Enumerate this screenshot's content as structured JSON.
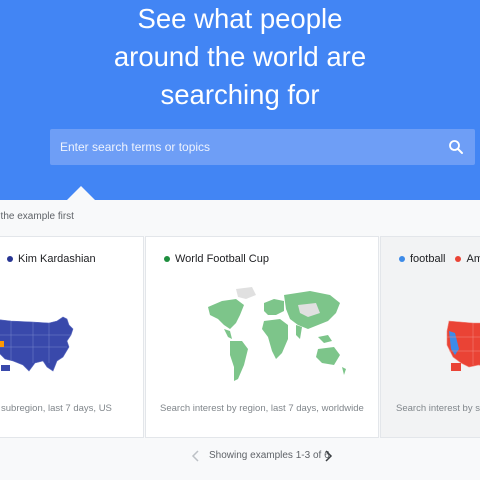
{
  "hero": {
    "title_lines": [
      "See what people",
      "around the world are",
      "searching for"
    ]
  },
  "search": {
    "placeholder": "Enter search terms or topics"
  },
  "intro": "t the example first",
  "cards": [
    {
      "legend": [
        {
          "label": "Kim Kardashian",
          "color": "#283593"
        }
      ],
      "caption": "subregion, last 7 days, US",
      "map_color": "#3949ab",
      "map": "us-map"
    },
    {
      "legend": [
        {
          "label": "World Football Cup",
          "color": "#1e8e3e"
        }
      ],
      "caption": "Search interest by region, last 7 days, worldwide",
      "map_color": "#7dc58a",
      "map": "world-map"
    },
    {
      "legend": [
        {
          "label": "football",
          "color": "#3d8be8"
        },
        {
          "label": "Am",
          "color": "#ea4335"
        }
      ],
      "caption": "Search interest by su",
      "map_color": "#ea4335",
      "map": "us-map"
    }
  ],
  "pager": {
    "text": "Showing examples 1-3 of 6"
  }
}
